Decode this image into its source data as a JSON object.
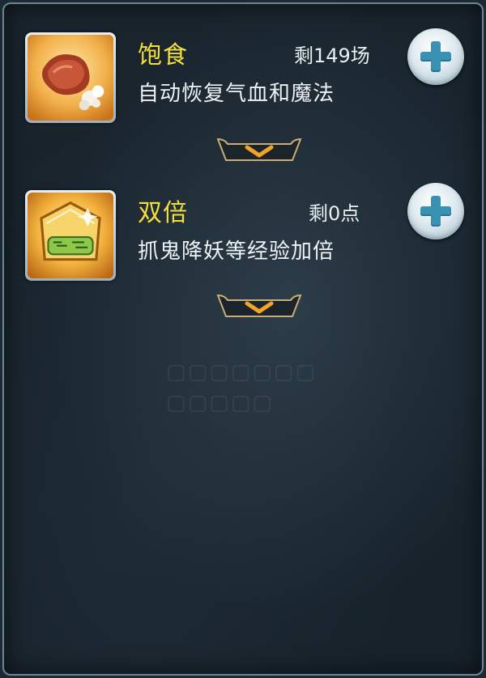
{
  "items": [
    {
      "icon": "roasted-meat-icon",
      "title": "饱食",
      "remaining": "剩149场",
      "description": "自动恢复气血和魔法"
    },
    {
      "icon": "double-exp-scroll-icon",
      "title": "双倍",
      "remaining": "剩0点",
      "description": "抓鬼降妖等经验加倍"
    }
  ],
  "colors": {
    "title": "#f3e03a",
    "text": "#eef3f5",
    "plus": "#3a92b3",
    "chevron": "#f0a428"
  }
}
